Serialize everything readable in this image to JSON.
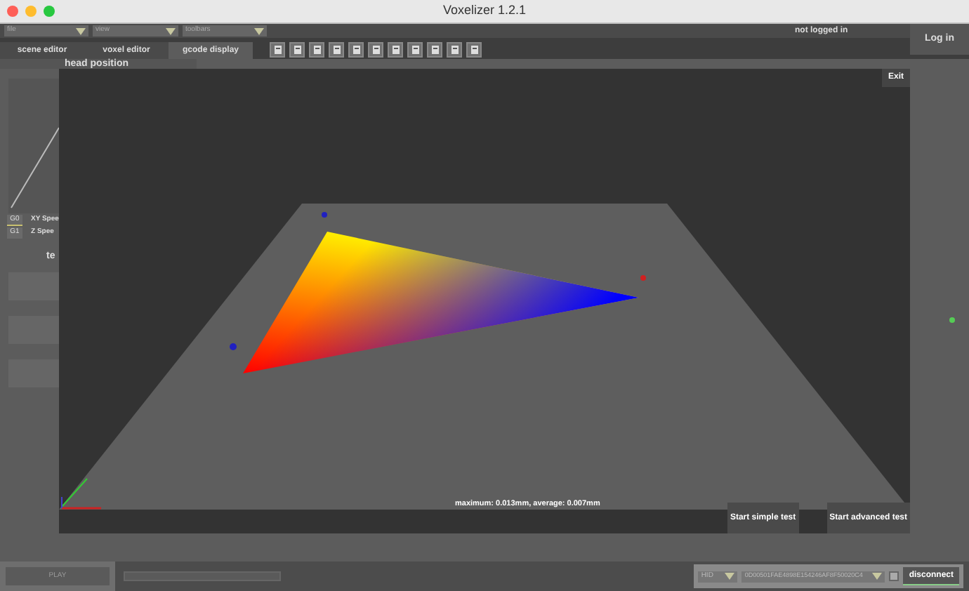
{
  "window": {
    "title": "Voxelizer 1.2.1"
  },
  "menus": [
    {
      "label": "file"
    },
    {
      "label": "view"
    },
    {
      "label": "toolbars"
    }
  ],
  "account": {
    "status": "not logged in",
    "login": "Log in"
  },
  "tabs": [
    {
      "label": "scene editor",
      "selected": false
    },
    {
      "label": "voxel editor",
      "selected": false
    },
    {
      "label": "gcode display",
      "selected": true
    }
  ],
  "head_position": {
    "title": "head position"
  },
  "gcode_buttons": [
    {
      "label": "G0",
      "selected": true
    },
    {
      "label": "G1",
      "selected": false
    }
  ],
  "speed_labels": [
    "XY Spee",
    "Z Spee"
  ],
  "section_title": "te",
  "calibration": {
    "exit": "Exit",
    "readout": "maximum: 0.013mm, average: 0.007mm",
    "buttons": [
      "Start simple test",
      "Start advanced test"
    ]
  },
  "playback": {
    "play": "PLAY"
  },
  "connection": {
    "port": "HID",
    "device": "0D00501FAE4898E154246AF8F50020C4",
    "disconnect": "disconnect"
  }
}
